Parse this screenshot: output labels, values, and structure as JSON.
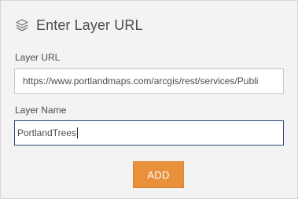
{
  "panel": {
    "title": "Enter Layer URL",
    "title_icon": "layers-icon"
  },
  "form": {
    "url_label": "Layer URL",
    "url_value": "https://www.portlandmaps.com/arcgis/rest/services/Publi",
    "name_label": "Layer Name",
    "name_value": "PortlandTrees",
    "add_label": "ADD"
  },
  "colors": {
    "panel_bg": "#f3f3f3",
    "accent": "#e8913a",
    "focus_border": "#2e4a7a"
  }
}
